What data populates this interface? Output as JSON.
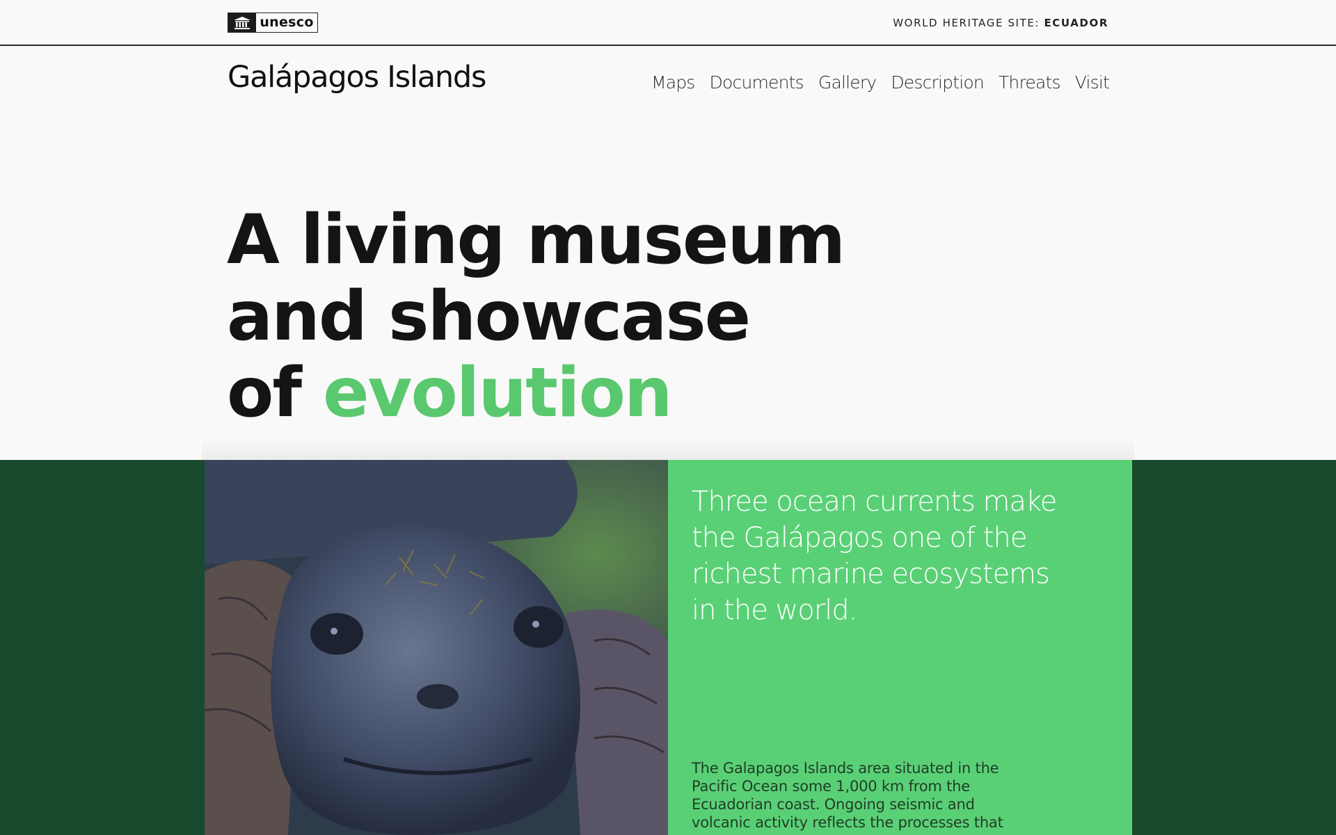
{
  "header": {
    "logo_text": "unesco",
    "site_prefix": "WORLD HERITAGE SITE:",
    "site_country": "ECUADOR"
  },
  "brand": {
    "title": "Galápagos Islands"
  },
  "nav": {
    "items": [
      {
        "label": "Maps"
      },
      {
        "label": "Documents"
      },
      {
        "label": "Gallery"
      },
      {
        "label": "Description"
      },
      {
        "label": "Threats"
      },
      {
        "label": "Visit"
      }
    ]
  },
  "hero": {
    "line1": "A living museum",
    "line2": "and showcase",
    "line3_prefix": "of",
    "line3_accent": "evolution"
  },
  "feature": {
    "quote": "Three ocean currents make the Galápagos one of the richest marine ecosystems in the world.",
    "body": "The Galapagos Islands area situated in the Pacific Ocean some 1,000 km from the Ecuadorian coast. Ongoing seismic and volcanic activity reflects the processes that"
  },
  "colors": {
    "accent_green": "#5ac86e",
    "card_green": "#5ad076",
    "band_dark_green": "#1a4a2e",
    "text_dark": "#141414"
  },
  "images": {
    "photo_subject": "giant-tortoise-photo"
  }
}
